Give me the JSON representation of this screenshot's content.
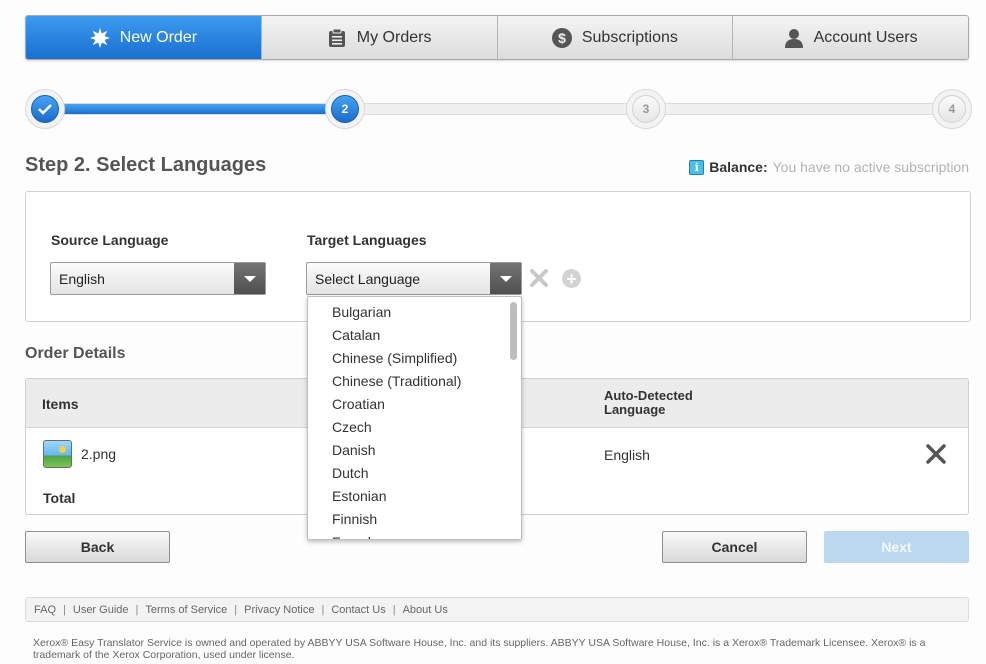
{
  "tabs": [
    {
      "label": "New Order",
      "icon": "starburst-icon",
      "active": true
    },
    {
      "label": "My Orders",
      "icon": "clipboard-icon",
      "active": false
    },
    {
      "label": "Subscriptions",
      "icon": "dollar-icon",
      "active": false
    },
    {
      "label": "Account Users",
      "icon": "user-icon",
      "active": false
    }
  ],
  "stepper": {
    "steps": [
      {
        "label": "",
        "state": "done"
      },
      {
        "label": "2",
        "state": "current"
      },
      {
        "label": "3",
        "state": "pending"
      },
      {
        "label": "4",
        "state": "pending"
      }
    ]
  },
  "page": {
    "title": "Step 2. Select Languages",
    "balance_label": "Balance:",
    "balance_value": "You have no active subscription"
  },
  "languages": {
    "source_label": "Source Language",
    "source_value": "English",
    "target_label": "Target Languages",
    "target_value": "Select Language",
    "options": [
      "Bulgarian",
      "Catalan",
      "Chinese (Simplified)",
      "Chinese (Traditional)",
      "Croatian",
      "Czech",
      "Danish",
      "Dutch",
      "Estonian",
      "Finnish",
      "French"
    ]
  },
  "order": {
    "title": "Order Details",
    "col_items": "Items",
    "col_auto_detected": "Auto-Detected Language",
    "file_name": "2.png",
    "detected_language": "English",
    "total_label": "Total"
  },
  "buttons": {
    "back": "Back",
    "cancel": "Cancel",
    "next": "Next"
  },
  "footer": {
    "links": [
      "FAQ",
      "User Guide",
      "Terms of Service",
      "Privacy Notice",
      "Contact Us",
      "About Us"
    ],
    "legal": "Xerox® Easy Translator Service is owned and operated by ABBYY USA Software House, Inc. and its suppliers. ABBYY USA Software House, Inc. is a Xerox® Trademark Licensee. Xerox® is a trademark of the Xerox Corporation, used under license."
  },
  "colors": {
    "accent_blue": "#1a6fd0",
    "disabled_blue": "#bcd8ee"
  }
}
